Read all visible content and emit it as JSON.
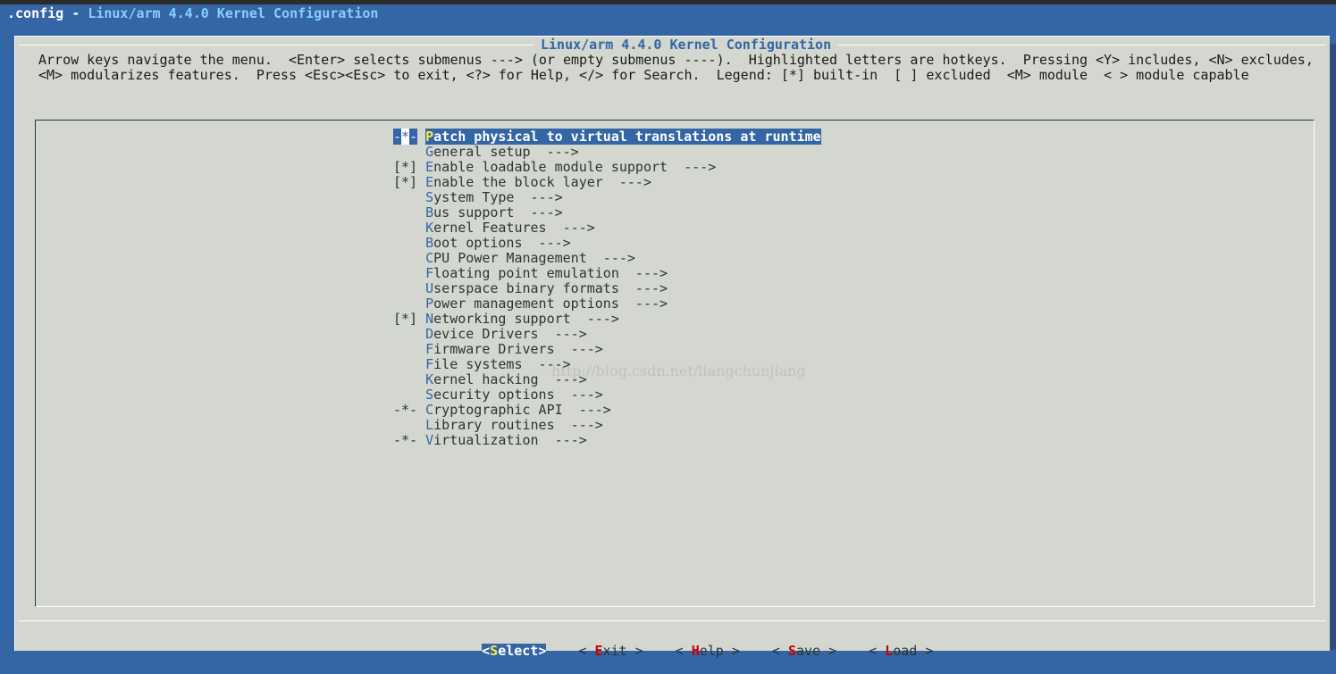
{
  "window": {
    "title_prefix": ".config - ",
    "title_main": "Linux/arm 4.4.0 Kernel Configuration"
  },
  "dialog": {
    "title": "Linux/arm 4.4.0 Kernel Configuration",
    "help_line_1": "Arrow keys navigate the menu.  <Enter> selects submenus ---> (or empty submenus ----).  Highlighted letters are hotkeys.  Pressing <Y> includes, <N> excludes,",
    "help_line_2": "<M> modularizes features.  Press <Esc><Esc> to exit, <?> for Help, </> for Search.  Legend: [*] built-in  [ ] excluded  <M> module  < > module capable"
  },
  "menu": {
    "items": [
      {
        "state": "-*-",
        "hot": "P",
        "rest": "atch physical to virtual translations at runtime",
        "suffix": "",
        "selected": true
      },
      {
        "state": "   ",
        "hot": "G",
        "rest": "eneral setup",
        "suffix": "  --->"
      },
      {
        "state": "[*]",
        "hot": "E",
        "rest": "nable loadable module support",
        "suffix": "  --->"
      },
      {
        "state": "[*]",
        "hot": "E",
        "rest": "nable the block layer",
        "suffix": "  --->"
      },
      {
        "state": "   ",
        "hot": "S",
        "rest": "ystem Type",
        "suffix": "  --->"
      },
      {
        "state": "   ",
        "hot": "B",
        "rest": "us support",
        "suffix": "  --->"
      },
      {
        "state": "   ",
        "hot": "K",
        "rest": "ernel Features",
        "suffix": "  --->"
      },
      {
        "state": "   ",
        "hot": "B",
        "rest": "oot options",
        "suffix": "  --->"
      },
      {
        "state": "   ",
        "hot": "C",
        "rest": "PU Power Management",
        "suffix": "  --->"
      },
      {
        "state": "   ",
        "hot": "F",
        "rest": "loating point emulation",
        "suffix": "  --->"
      },
      {
        "state": "   ",
        "hot": "U",
        "rest": "serspace binary formats",
        "suffix": "  --->"
      },
      {
        "state": "   ",
        "hot": "P",
        "rest": "ower management options",
        "suffix": "  --->"
      },
      {
        "state": "[*]",
        "hot": "N",
        "rest": "etworking support",
        "suffix": "  --->"
      },
      {
        "state": "   ",
        "hot": "D",
        "rest": "evice Drivers",
        "suffix": "  --->"
      },
      {
        "state": "   ",
        "hot": "F",
        "rest": "irmware Drivers",
        "suffix": "  --->"
      },
      {
        "state": "   ",
        "hot": "F",
        "rest": "ile systems",
        "suffix": "  --->"
      },
      {
        "state": "   ",
        "hot": "K",
        "rest": "ernel hacking",
        "suffix": "  --->"
      },
      {
        "state": "   ",
        "hot": "S",
        "rest": "ecurity options",
        "suffix": "  --->"
      },
      {
        "state": "-*-",
        "hot": "C",
        "rest": "ryptographic API",
        "suffix": "  --->"
      },
      {
        "state": "   ",
        "hot": "L",
        "rest": "ibrary routines",
        "suffix": "  --->"
      },
      {
        "state": "-*-",
        "hot": "V",
        "rest": "irtualization",
        "suffix": "  --->"
      }
    ]
  },
  "buttons": {
    "select": {
      "pre": "<",
      "hot": "S",
      "rest": "elect",
      "post": ">"
    },
    "exit": {
      "pre": "< ",
      "hot": "E",
      "rest": "xit",
      "post": " >"
    },
    "help": {
      "pre": "< ",
      "hot": "H",
      "rest": "elp",
      "post": " >"
    },
    "save": {
      "pre": "< ",
      "hot": "S",
      "rest": "ave",
      "post": " >"
    },
    "load": {
      "pre": "< ",
      "hot": "L",
      "rest": "oad",
      "post": " >"
    }
  },
  "watermark": "http://blog.csdn.net/liangchunjiang",
  "colors": {
    "background": "#3465a4",
    "dialog": "#d3d7cf",
    "highlight": "#3465a4",
    "hotkey": "#3465a4",
    "button_hotkey": "#cc0000"
  }
}
